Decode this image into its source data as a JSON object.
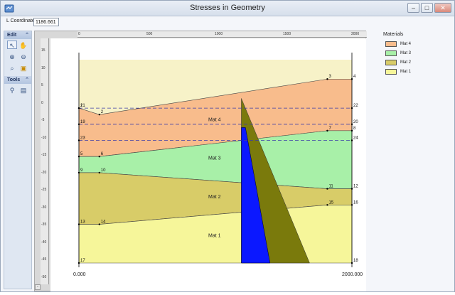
{
  "window": {
    "title": "Stresses in Geometry"
  },
  "toolbar": {
    "coordinate_label": "L Coordinate",
    "coordinate_value": "1186.661"
  },
  "left_panel": {
    "edit_group": {
      "label": "Edit",
      "tools": [
        "pointer-icon",
        "hand-icon",
        "zoom-in-icon",
        "zoom-out-icon",
        "zoom-window-icon",
        "zoom-extents-icon"
      ]
    },
    "tools_group": {
      "label": "Tools",
      "tools": [
        "probe-icon",
        "query-icon"
      ]
    }
  },
  "rulers": {
    "horizontal": [
      "0",
      "500",
      "1000",
      "1500",
      "2000"
    ],
    "vertical": [
      "15",
      "10",
      "5",
      "0",
      "-5",
      "-10",
      "-15",
      "-20",
      "-25",
      "-30",
      "-35",
      "-40",
      "-45",
      "-50"
    ]
  },
  "plot": {
    "x_range": [
      0,
      2000
    ],
    "y_range": [
      -48,
      15
    ],
    "x_start_label": "0.000",
    "x_end_label": "2000.000",
    "layers": [
      {
        "name": "Mat 4",
        "color": "#f8bc8c"
      },
      {
        "name": "Mat 3",
        "color": "#a8f0a8"
      },
      {
        "name": "Mat 2",
        "color": "#d8cc68"
      },
      {
        "name": "Mat 1",
        "color": "#f6f69a"
      }
    ],
    "points": [
      {
        "id": "1",
        "x": 0,
        "y": 0
      },
      {
        "id": "2",
        "x": 150,
        "y": -2
      },
      {
        "id": "3",
        "x": 1820,
        "y": 9
      },
      {
        "id": "4",
        "x": 2000,
        "y": 9
      },
      {
        "id": "5",
        "x": 0,
        "y": -15
      },
      {
        "id": "6",
        "x": 150,
        "y": -15
      },
      {
        "id": "7",
        "x": 1820,
        "y": -7
      },
      {
        "id": "8",
        "x": 2000,
        "y": -7
      },
      {
        "id": "9",
        "x": 0,
        "y": -20
      },
      {
        "id": "10",
        "x": 150,
        "y": -20
      },
      {
        "id": "11",
        "x": 1820,
        "y": -25
      },
      {
        "id": "12",
        "x": 2000,
        "y": -25
      },
      {
        "id": "13",
        "x": 0,
        "y": -36
      },
      {
        "id": "14",
        "x": 150,
        "y": -36
      },
      {
        "id": "15",
        "x": 1820,
        "y": -30
      },
      {
        "id": "16",
        "x": 2000,
        "y": -30
      },
      {
        "id": "17",
        "x": 0,
        "y": -48
      },
      {
        "id": "18",
        "x": 2000,
        "y": -48
      },
      {
        "id": "19",
        "x": 0,
        "y": -5
      },
      {
        "id": "20",
        "x": 2000,
        "y": -5
      },
      {
        "id": "21",
        "x": 0,
        "y": 0
      },
      {
        "id": "22",
        "x": 2000,
        "y": 0
      },
      {
        "id": "23",
        "x": 0,
        "y": -10
      },
      {
        "id": "24",
        "x": 2000,
        "y": -10
      }
    ]
  },
  "legend": {
    "title": "Materials",
    "items": [
      {
        "label": "Mat 4",
        "color": "#f8bc8c"
      },
      {
        "label": "Mat 3",
        "color": "#a8f0a8"
      },
      {
        "label": "Mat 2",
        "color": "#d8cc68"
      },
      {
        "label": "Mat 1",
        "color": "#f6f69a"
      }
    ]
  }
}
